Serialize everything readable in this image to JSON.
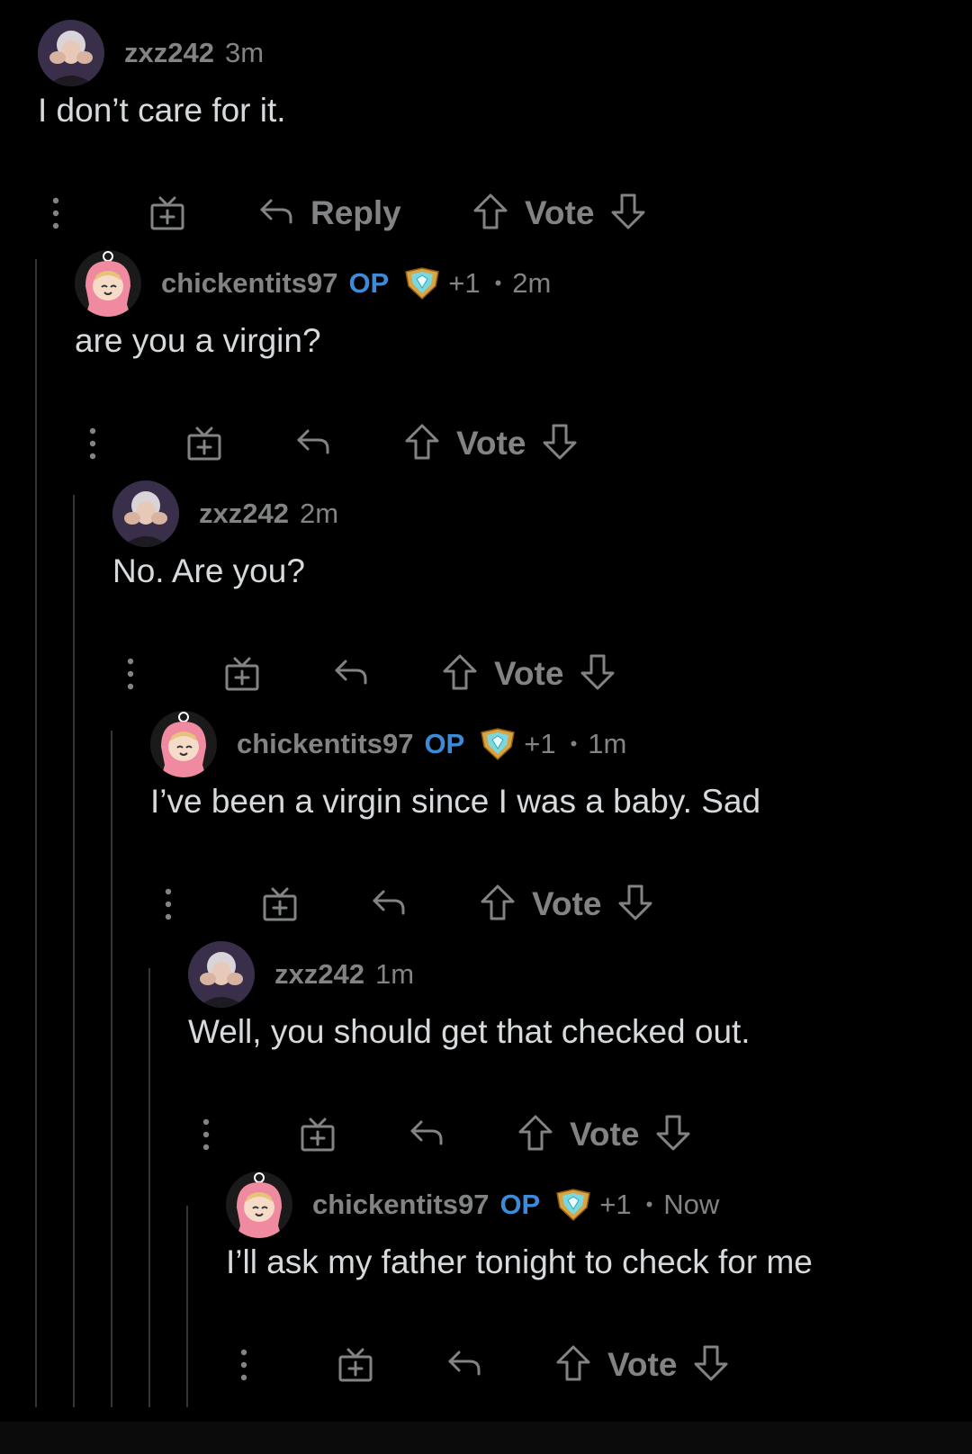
{
  "comments": [
    {
      "username": "zxz242",
      "time": "3m",
      "body": "I don’t care for it.",
      "reply_label": "Reply",
      "vote_label": "Vote",
      "avatar": "elderly-woman-avatar"
    },
    {
      "username": "chickentits97",
      "op_tag": "OP",
      "award_count": "+1",
      "separator": "•",
      "time": "2m",
      "body": "are you a virgin?",
      "vote_label": "Vote",
      "avatar": "pink-hooded-character-avatar"
    },
    {
      "username": "zxz242",
      "time": "2m",
      "body": "No. Are you?",
      "vote_label": "Vote",
      "avatar": "elderly-woman-avatar"
    },
    {
      "username": "chickentits97",
      "op_tag": "OP",
      "award_count": "+1",
      "separator": "•",
      "time": "1m",
      "body": "I’ve been a virgin since I was a baby. Sad",
      "vote_label": "Vote",
      "avatar": "pink-hooded-character-avatar"
    },
    {
      "username": "zxz242",
      "time": "1m",
      "body": "Well, you should get that checked out.",
      "vote_label": "Vote",
      "avatar": "elderly-woman-avatar"
    },
    {
      "username": "chickentits97",
      "op_tag": "OP",
      "award_count": "+1",
      "separator": "•",
      "time": "Now",
      "body": "I’ll ask my father tonight to check for me",
      "vote_label": "Vote",
      "avatar": "pink-hooded-character-avatar"
    }
  ],
  "icons": {
    "more": "more-options-icon",
    "gift": "gift-award-icon",
    "reply": "reply-arrow-icon",
    "upvote": "upvote-arrow-icon",
    "downvote": "downvote-arrow-icon",
    "award": "shield-gem-award-icon"
  },
  "colors": {
    "background": "#000000",
    "body_text": "#d7dadc",
    "meta_text": "#818384",
    "op_tag": "#3c8ad8",
    "thread_line": "#343536"
  }
}
